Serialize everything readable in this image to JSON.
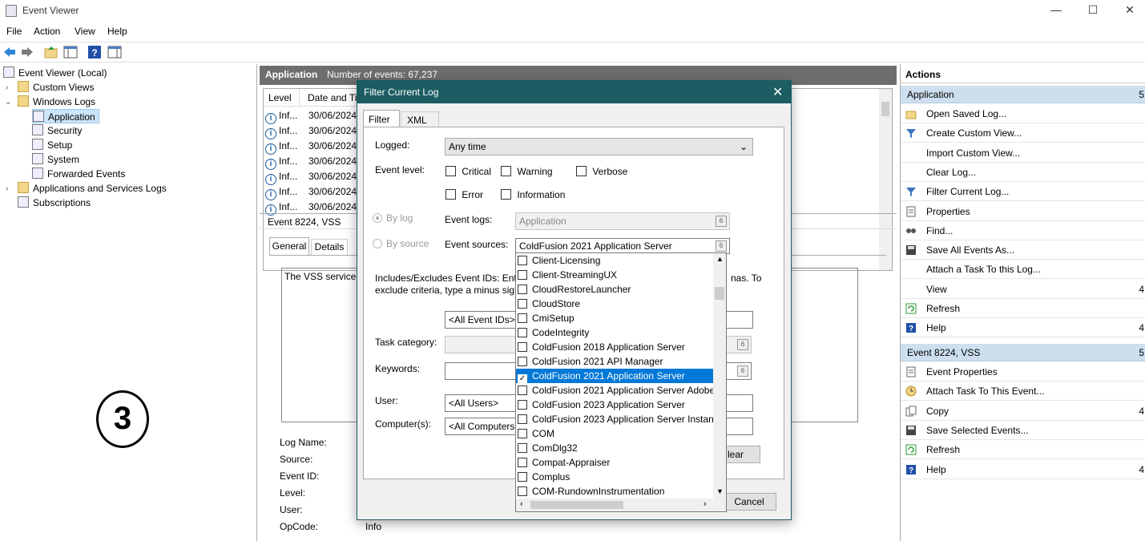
{
  "window": {
    "title": "Event Viewer",
    "minimize": "—",
    "maximize": "☐",
    "close": "✕"
  },
  "menu": [
    "File",
    "Action",
    "View",
    "Help"
  ],
  "tree": {
    "root": "Event Viewer (Local)",
    "custom_views": "Custom Views",
    "windows_logs": "Windows Logs",
    "application": "Application",
    "security": "Security",
    "setup": "Setup",
    "system": "System",
    "forwarded": "Forwarded Events",
    "apps_services": "Applications and Services Logs",
    "subscriptions": "Subscriptions"
  },
  "center": {
    "log_name": "Application",
    "event_count": "Number of events: 67,237",
    "col_level": "Level",
    "col_date": "Date and Ti",
    "rows": [
      {
        "level": "Inf...",
        "date": "30/06/2024"
      },
      {
        "level": "Inf...",
        "date": "30/06/2024"
      },
      {
        "level": "Inf...",
        "date": "30/06/2024"
      },
      {
        "level": "Inf...",
        "date": "30/06/2024"
      },
      {
        "level": "Inf...",
        "date": "30/06/2024"
      },
      {
        "level": "Inf...",
        "date": "30/06/2024"
      },
      {
        "level": "Inf...",
        "date": "30/06/2024"
      }
    ],
    "detail_title": "Event 8224, VSS",
    "tab_general": "General",
    "tab_details": "Details",
    "description": "The VSS service is",
    "labels": {
      "log_name": "Log Name:",
      "source": "Source:",
      "event_id": "Event ID:",
      "level": "Level:",
      "user": "User:",
      "opcode": "OpCode:",
      "opcode_value": "Info"
    }
  },
  "dialog": {
    "title": "Filter Current Log",
    "tab_filter": "Filter",
    "tab_xml": "XML",
    "logged_label": "Logged:",
    "logged_value": "Any time",
    "event_level_label": "Event level:",
    "critical": "Critical",
    "warning": "Warning",
    "verbose": "Verbose",
    "error": "Error",
    "information": "Information",
    "by_log": "By log",
    "by_source": "By source",
    "event_logs_label": "Event logs:",
    "event_logs_value": "Application",
    "event_sources_label": "Event sources:",
    "event_sources_value": "ColdFusion 2021 Application Server",
    "includes_text_1": "Includes/Excludes Event IDs: Ente",
    "includes_text_1b": "nas. To",
    "includes_text_2": "exclude criteria, type a minus sign",
    "event_ids_value": "<All Event IDs>",
    "task_category_label": "Task category:",
    "keywords_label": "Keywords:",
    "user_label": "User:",
    "user_value": "<All Users>",
    "computers_label": "Computer(s):",
    "computers_value": "<All Computers",
    "clear_btn": "lear",
    "cancel_btn": "Cancel"
  },
  "sources": [
    {
      "label": "Client-Licensing",
      "checked": false
    },
    {
      "label": "Client-StreamingUX",
      "checked": false
    },
    {
      "label": "CloudRestoreLauncher",
      "checked": false
    },
    {
      "label": "CloudStore",
      "checked": false
    },
    {
      "label": "CmiSetup",
      "checked": false
    },
    {
      "label": "CodeIntegrity",
      "checked": false
    },
    {
      "label": "ColdFusion 2018 Application Server",
      "checked": false
    },
    {
      "label": "ColdFusion 2021 API Manager",
      "checked": false
    },
    {
      "label": "ColdFusion 2021 Application Server",
      "checked": true
    },
    {
      "label": "ColdFusion 2021 Application Server Adobe_",
      "checked": false
    },
    {
      "label": "ColdFusion 2023 Application Server",
      "checked": false
    },
    {
      "label": "ColdFusion 2023 Application Server Instanc",
      "checked": false
    },
    {
      "label": "COM",
      "checked": false
    },
    {
      "label": "ComDlg32",
      "checked": false
    },
    {
      "label": "Compat-Appraiser",
      "checked": false
    },
    {
      "label": "Complus",
      "checked": false
    },
    {
      "label": "COM-RundownInstrumentation",
      "checked": false
    }
  ],
  "actions": {
    "header": "Actions",
    "section1": "Application",
    "section1_arrow": "5",
    "items1": [
      {
        "label": "Open Saved Log...",
        "icon": "folder-icon"
      },
      {
        "label": "Create Custom View...",
        "icon": "filter-icon"
      },
      {
        "label": "Import Custom View...",
        "icon": ""
      },
      {
        "label": "Clear Log...",
        "icon": ""
      },
      {
        "label": "Filter Current Log...",
        "icon": "filter-icon"
      },
      {
        "label": "Properties",
        "icon": "properties-icon"
      },
      {
        "label": "Find...",
        "icon": "find-icon"
      },
      {
        "label": "Save All Events As...",
        "icon": "save-icon"
      },
      {
        "label": "Attach a Task To this Log...",
        "icon": ""
      },
      {
        "label": "View",
        "icon": "",
        "arrow": "4"
      },
      {
        "label": "Refresh",
        "icon": "refresh-icon"
      },
      {
        "label": "Help",
        "icon": "help-icon",
        "arrow": "4"
      }
    ],
    "section2": "Event 8224, VSS",
    "section2_arrow": "5",
    "items2": [
      {
        "label": "Event Properties",
        "icon": "properties-icon"
      },
      {
        "label": "Attach Task To This Event...",
        "icon": "task-icon"
      },
      {
        "label": "Copy",
        "icon": "copy-icon",
        "arrow": "4"
      },
      {
        "label": "Save Selected Events...",
        "icon": "save-icon"
      },
      {
        "label": "Refresh",
        "icon": "refresh-icon"
      },
      {
        "label": "Help",
        "icon": "help-icon",
        "arrow": "4"
      }
    ]
  },
  "step_number": "3"
}
